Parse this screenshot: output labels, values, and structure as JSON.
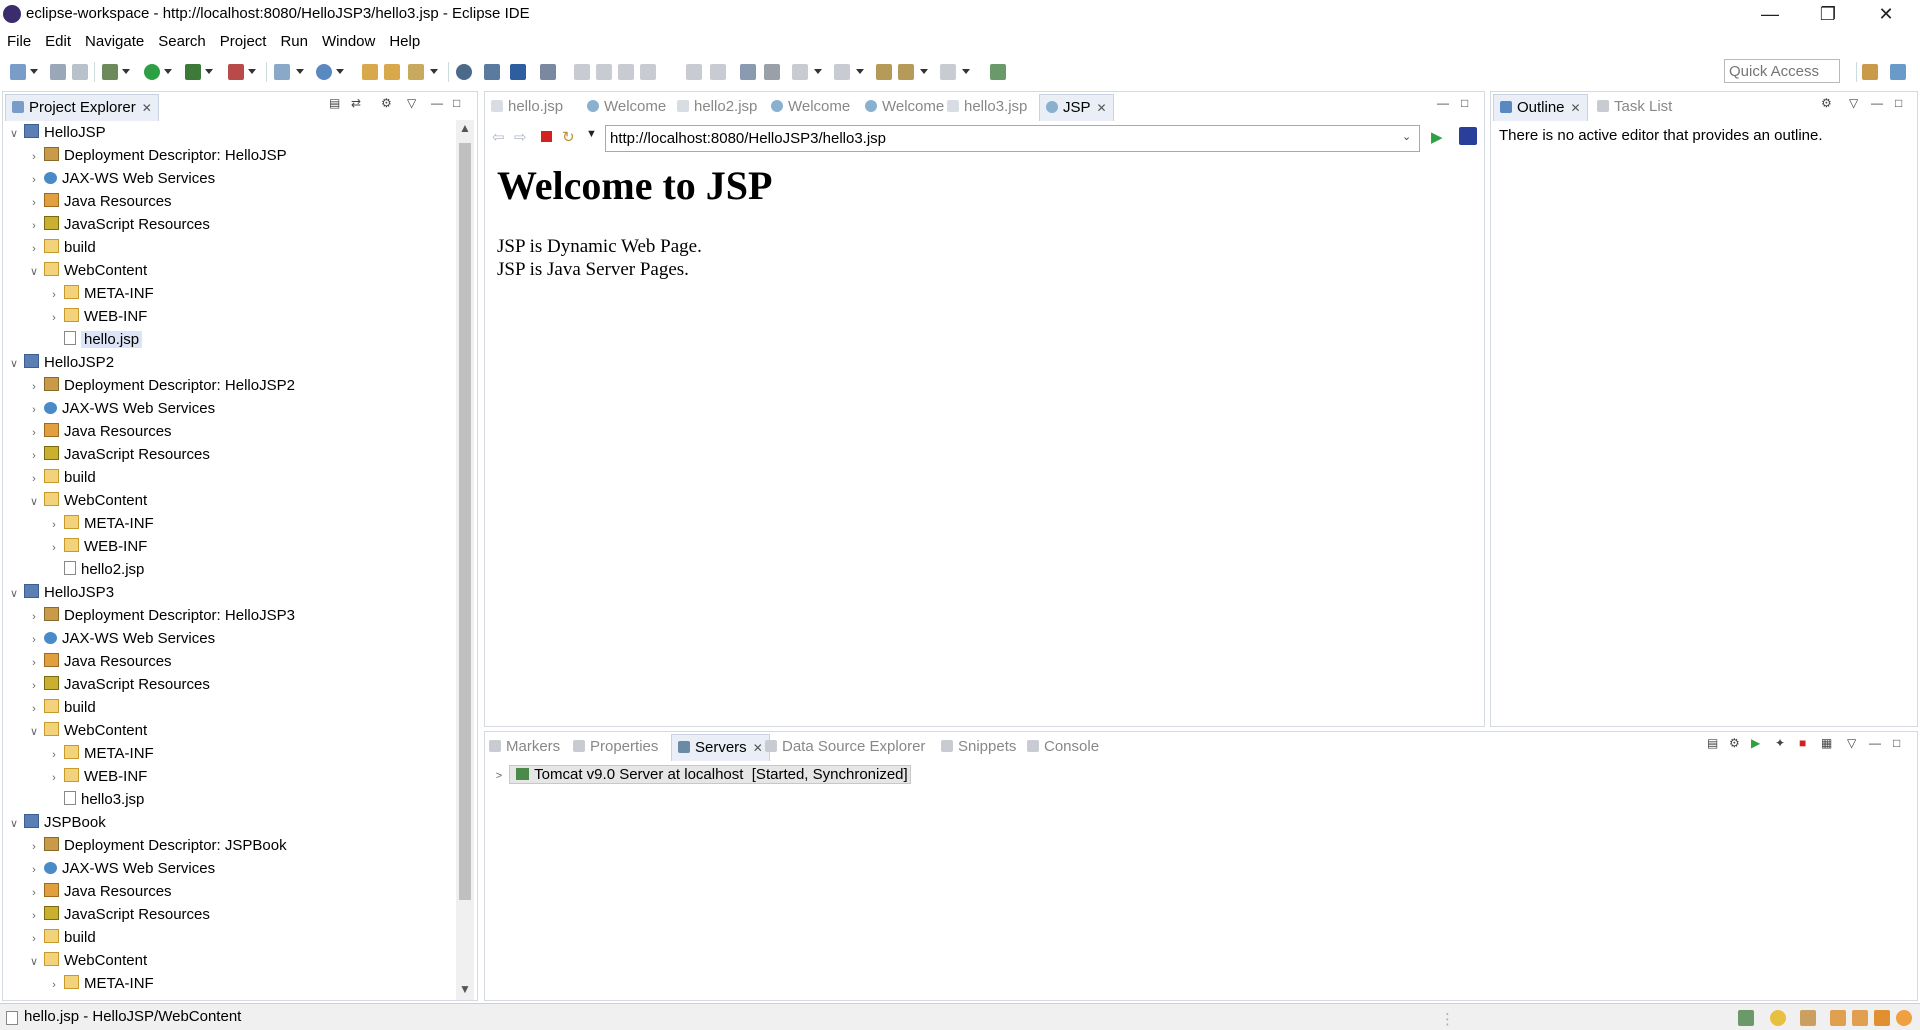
{
  "window": {
    "title": "eclipse-workspace - http://localhost:8080/HelloJSP3/hello3.jsp - Eclipse IDE"
  },
  "menu": [
    "File",
    "Edit",
    "Navigate",
    "Search",
    "Project",
    "Run",
    "Window",
    "Help"
  ],
  "quick_access": {
    "placeholder": "Quick Access"
  },
  "explorer": {
    "tab_label": "Project Explorer",
    "items": [
      {
        "label": "HelloJSP",
        "icon": "project-icon",
        "tw": "v"
      },
      {
        "label": "Deployment Descriptor: HelloJSP",
        "icon": "deployment-descriptor-icon",
        "tw": ">"
      },
      {
        "label": "JAX-WS Web Services",
        "icon": "web-services-icon",
        "tw": ">"
      },
      {
        "label": "Java Resources",
        "icon": "java-resources-icon",
        "tw": ">"
      },
      {
        "label": "JavaScript Resources",
        "icon": "javascript-resources-icon",
        "tw": ">"
      },
      {
        "label": "build",
        "icon": "folder-icon",
        "tw": ">"
      },
      {
        "label": "WebContent",
        "icon": "folder-icon",
        "tw": "v"
      },
      {
        "label": "META-INF",
        "icon": "folder-icon",
        "tw": ">"
      },
      {
        "label": "WEB-INF",
        "icon": "folder-icon",
        "tw": ">"
      },
      {
        "label": "hello.jsp",
        "icon": "jsp-file-icon",
        "tw": ""
      },
      {
        "label": "HelloJSP2",
        "icon": "project-icon",
        "tw": "v"
      },
      {
        "label": "Deployment Descriptor: HelloJSP2",
        "icon": "deployment-descriptor-icon",
        "tw": ">"
      },
      {
        "label": "JAX-WS Web Services",
        "icon": "web-services-icon",
        "tw": ">"
      },
      {
        "label": "Java Resources",
        "icon": "java-resources-icon",
        "tw": ">"
      },
      {
        "label": "JavaScript Resources",
        "icon": "javascript-resources-icon",
        "tw": ">"
      },
      {
        "label": "build",
        "icon": "folder-icon",
        "tw": ">"
      },
      {
        "label": "WebContent",
        "icon": "folder-icon",
        "tw": "v"
      },
      {
        "label": "META-INF",
        "icon": "folder-icon",
        "tw": ">"
      },
      {
        "label": "WEB-INF",
        "icon": "folder-icon",
        "tw": ">"
      },
      {
        "label": "hello2.jsp",
        "icon": "jsp-file-icon",
        "tw": ""
      },
      {
        "label": "HelloJSP3",
        "icon": "project-icon",
        "tw": "v"
      },
      {
        "label": "Deployment Descriptor: HelloJSP3",
        "icon": "deployment-descriptor-icon",
        "tw": ">"
      },
      {
        "label": "JAX-WS Web Services",
        "icon": "web-services-icon",
        "tw": ">"
      },
      {
        "label": "Java Resources",
        "icon": "java-resources-icon",
        "tw": ">"
      },
      {
        "label": "JavaScript Resources",
        "icon": "javascript-resources-icon",
        "tw": ">"
      },
      {
        "label": "build",
        "icon": "folder-icon",
        "tw": ">"
      },
      {
        "label": "WebContent",
        "icon": "folder-icon",
        "tw": "v"
      },
      {
        "label": "META-INF",
        "icon": "folder-icon",
        "tw": ">"
      },
      {
        "label": "WEB-INF",
        "icon": "folder-icon",
        "tw": ">"
      },
      {
        "label": "hello3.jsp",
        "icon": "jsp-file-icon",
        "tw": ""
      },
      {
        "label": "JSPBook",
        "icon": "project-icon",
        "tw": "v"
      },
      {
        "label": "Deployment Descriptor: JSPBook",
        "icon": "deployment-descriptor-icon",
        "tw": ">"
      },
      {
        "label": "JAX-WS Web Services",
        "icon": "web-services-icon",
        "tw": ">"
      },
      {
        "label": "Java Resources",
        "icon": "java-resources-icon",
        "tw": ">"
      },
      {
        "label": "JavaScript Resources",
        "icon": "javascript-resources-icon",
        "tw": ">"
      },
      {
        "label": "build",
        "icon": "folder-icon",
        "tw": ">"
      },
      {
        "label": "WebContent",
        "icon": "folder-icon",
        "tw": "v"
      },
      {
        "label": "META-INF",
        "icon": "folder-icon",
        "tw": ">"
      }
    ],
    "selected_index": 9
  },
  "editor": {
    "tabs": [
      "hello.jsp",
      "Welcome",
      "hello2.jsp",
      "Welcome",
      "Welcome",
      "hello3.jsp",
      "JSP"
    ],
    "active_tab": 6,
    "url": "http://localhost:8080/HelloJSP3/hello3.jsp",
    "page": {
      "heading": "Welcome to JSP",
      "lines": [
        "JSP is Dynamic Web Page.",
        "JSP is Java Server Pages."
      ]
    }
  },
  "outline": {
    "tabs": [
      "Outline",
      "Task List"
    ],
    "message": "There is no active editor that provides an outline."
  },
  "bottom": {
    "tabs": [
      "Markers",
      "Properties",
      "Servers",
      "Data Source Explorer",
      "Snippets",
      "Console"
    ],
    "active_tab": 2,
    "server_row": "Tomcat v9.0 Server at localhost  [Started, Synchronized]"
  },
  "status": {
    "text": "hello.jsp - HelloJSP/WebContent"
  }
}
